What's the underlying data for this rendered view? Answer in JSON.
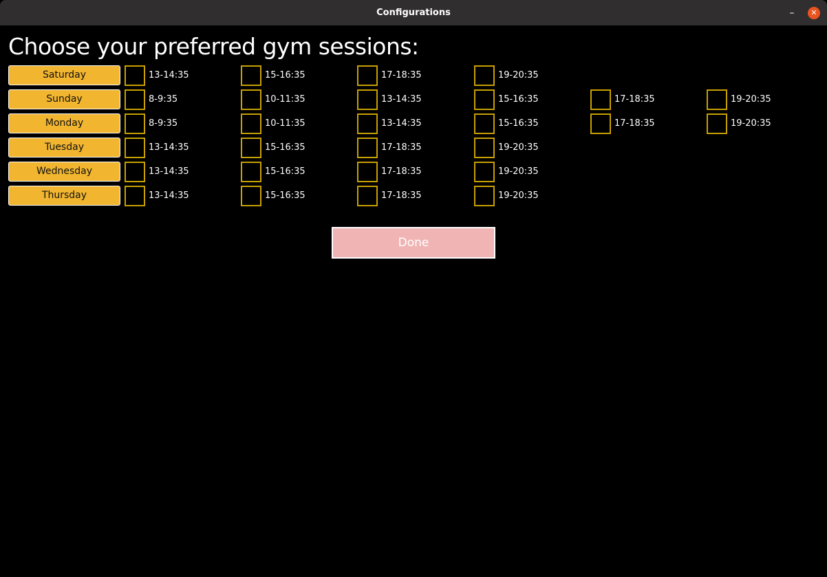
{
  "window": {
    "title": "Configurations",
    "minimize_icon": "minimize-icon",
    "close_icon": "close-icon",
    "accent": "#e95420"
  },
  "heading": "Choose your preferred gym sessions:",
  "colors": {
    "day_button": "#f1b52f",
    "checkbox_border": "#c9a100",
    "done_button": "#f0b4b4"
  },
  "days": [
    {
      "label": "Saturday",
      "sessions": [
        "13-14:35",
        "15-16:35",
        "17-18:35",
        "19-20:35"
      ]
    },
    {
      "label": "Sunday",
      "sessions": [
        "8-9:35",
        "10-11:35",
        "13-14:35",
        "15-16:35",
        "17-18:35",
        "19-20:35"
      ]
    },
    {
      "label": "Monday",
      "sessions": [
        "8-9:35",
        "10-11:35",
        "13-14:35",
        "15-16:35",
        "17-18:35",
        "19-20:35"
      ]
    },
    {
      "label": "Tuesday",
      "sessions": [
        "13-14:35",
        "15-16:35",
        "17-18:35",
        "19-20:35"
      ]
    },
    {
      "label": "Wednesday",
      "sessions": [
        "13-14:35",
        "15-16:35",
        "17-18:35",
        "19-20:35"
      ]
    },
    {
      "label": "Thursday",
      "sessions": [
        "13-14:35",
        "15-16:35",
        "17-18:35",
        "19-20:35"
      ]
    }
  ],
  "done_label": "Done"
}
